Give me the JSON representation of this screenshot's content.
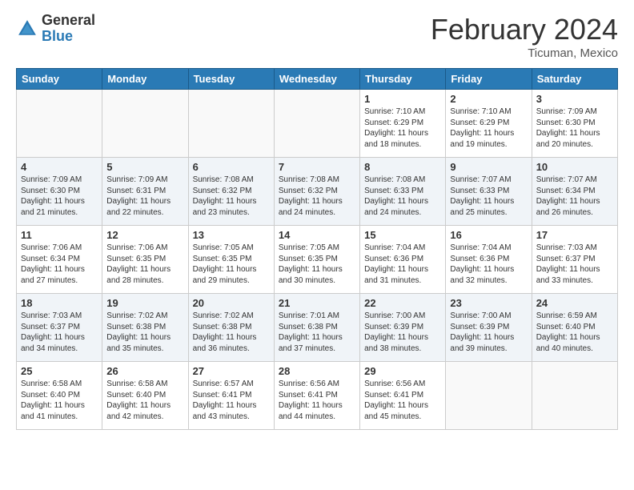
{
  "header": {
    "logo_general": "General",
    "logo_blue": "Blue",
    "month_title": "February 2024",
    "location": "Ticuman, Mexico"
  },
  "weekdays": [
    "Sunday",
    "Monday",
    "Tuesday",
    "Wednesday",
    "Thursday",
    "Friday",
    "Saturday"
  ],
  "weeks": [
    [
      {
        "day": "",
        "info": ""
      },
      {
        "day": "",
        "info": ""
      },
      {
        "day": "",
        "info": ""
      },
      {
        "day": "",
        "info": ""
      },
      {
        "day": "1",
        "info": "Sunrise: 7:10 AM\nSunset: 6:29 PM\nDaylight: 11 hours and 18 minutes."
      },
      {
        "day": "2",
        "info": "Sunrise: 7:10 AM\nSunset: 6:29 PM\nDaylight: 11 hours and 19 minutes."
      },
      {
        "day": "3",
        "info": "Sunrise: 7:09 AM\nSunset: 6:30 PM\nDaylight: 11 hours and 20 minutes."
      }
    ],
    [
      {
        "day": "4",
        "info": "Sunrise: 7:09 AM\nSunset: 6:30 PM\nDaylight: 11 hours and 21 minutes."
      },
      {
        "day": "5",
        "info": "Sunrise: 7:09 AM\nSunset: 6:31 PM\nDaylight: 11 hours and 22 minutes."
      },
      {
        "day": "6",
        "info": "Sunrise: 7:08 AM\nSunset: 6:32 PM\nDaylight: 11 hours and 23 minutes."
      },
      {
        "day": "7",
        "info": "Sunrise: 7:08 AM\nSunset: 6:32 PM\nDaylight: 11 hours and 24 minutes."
      },
      {
        "day": "8",
        "info": "Sunrise: 7:08 AM\nSunset: 6:33 PM\nDaylight: 11 hours and 24 minutes."
      },
      {
        "day": "9",
        "info": "Sunrise: 7:07 AM\nSunset: 6:33 PM\nDaylight: 11 hours and 25 minutes."
      },
      {
        "day": "10",
        "info": "Sunrise: 7:07 AM\nSunset: 6:34 PM\nDaylight: 11 hours and 26 minutes."
      }
    ],
    [
      {
        "day": "11",
        "info": "Sunrise: 7:06 AM\nSunset: 6:34 PM\nDaylight: 11 hours and 27 minutes."
      },
      {
        "day": "12",
        "info": "Sunrise: 7:06 AM\nSunset: 6:35 PM\nDaylight: 11 hours and 28 minutes."
      },
      {
        "day": "13",
        "info": "Sunrise: 7:05 AM\nSunset: 6:35 PM\nDaylight: 11 hours and 29 minutes."
      },
      {
        "day": "14",
        "info": "Sunrise: 7:05 AM\nSunset: 6:35 PM\nDaylight: 11 hours and 30 minutes."
      },
      {
        "day": "15",
        "info": "Sunrise: 7:04 AM\nSunset: 6:36 PM\nDaylight: 11 hours and 31 minutes."
      },
      {
        "day": "16",
        "info": "Sunrise: 7:04 AM\nSunset: 6:36 PM\nDaylight: 11 hours and 32 minutes."
      },
      {
        "day": "17",
        "info": "Sunrise: 7:03 AM\nSunset: 6:37 PM\nDaylight: 11 hours and 33 minutes."
      }
    ],
    [
      {
        "day": "18",
        "info": "Sunrise: 7:03 AM\nSunset: 6:37 PM\nDaylight: 11 hours and 34 minutes."
      },
      {
        "day": "19",
        "info": "Sunrise: 7:02 AM\nSunset: 6:38 PM\nDaylight: 11 hours and 35 minutes."
      },
      {
        "day": "20",
        "info": "Sunrise: 7:02 AM\nSunset: 6:38 PM\nDaylight: 11 hours and 36 minutes."
      },
      {
        "day": "21",
        "info": "Sunrise: 7:01 AM\nSunset: 6:38 PM\nDaylight: 11 hours and 37 minutes."
      },
      {
        "day": "22",
        "info": "Sunrise: 7:00 AM\nSunset: 6:39 PM\nDaylight: 11 hours and 38 minutes."
      },
      {
        "day": "23",
        "info": "Sunrise: 7:00 AM\nSunset: 6:39 PM\nDaylight: 11 hours and 39 minutes."
      },
      {
        "day": "24",
        "info": "Sunrise: 6:59 AM\nSunset: 6:40 PM\nDaylight: 11 hours and 40 minutes."
      }
    ],
    [
      {
        "day": "25",
        "info": "Sunrise: 6:58 AM\nSunset: 6:40 PM\nDaylight: 11 hours and 41 minutes."
      },
      {
        "day": "26",
        "info": "Sunrise: 6:58 AM\nSunset: 6:40 PM\nDaylight: 11 hours and 42 minutes."
      },
      {
        "day": "27",
        "info": "Sunrise: 6:57 AM\nSunset: 6:41 PM\nDaylight: 11 hours and 43 minutes."
      },
      {
        "day": "28",
        "info": "Sunrise: 6:56 AM\nSunset: 6:41 PM\nDaylight: 11 hours and 44 minutes."
      },
      {
        "day": "29",
        "info": "Sunrise: 6:56 AM\nSunset: 6:41 PM\nDaylight: 11 hours and 45 minutes."
      },
      {
        "day": "",
        "info": ""
      },
      {
        "day": "",
        "info": ""
      }
    ]
  ]
}
